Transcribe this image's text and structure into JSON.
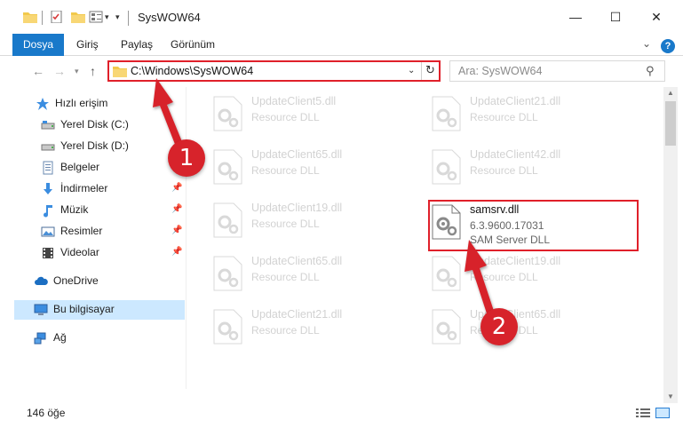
{
  "window": {
    "title": "SysWOW64",
    "minimize": "—",
    "maximize": "☐",
    "close": "✕"
  },
  "ribbon": {
    "tabs": [
      "Dosya",
      "Giriş",
      "Paylaş",
      "Görünüm"
    ],
    "help": "?"
  },
  "address": {
    "path": "C:\\Windows\\SysWOW64",
    "search_placeholder": "Ara: SysWOW64"
  },
  "sidebar": {
    "items": [
      {
        "label": "Hızlı erişim",
        "icon": "star-icon"
      },
      {
        "label": "Yerel Disk (C:)",
        "icon": "drive-icon"
      },
      {
        "label": "Yerel Disk (D:)",
        "icon": "drive-icon"
      },
      {
        "label": "Belgeler",
        "icon": "documents-icon"
      },
      {
        "label": "İndirmeler",
        "icon": "download-icon"
      },
      {
        "label": "Müzik",
        "icon": "music-icon"
      },
      {
        "label": "Resimler",
        "icon": "pictures-icon"
      },
      {
        "label": "Videolar",
        "icon": "video-icon"
      },
      {
        "label": "OneDrive",
        "icon": "cloud-icon"
      },
      {
        "label": "Bu bilgisayar",
        "icon": "computer-icon"
      },
      {
        "label": "Ağ",
        "icon": "network-icon"
      }
    ]
  },
  "files": {
    "left": [
      {
        "name": "UpdateClient5.dll",
        "desc": "Resource DLL"
      },
      {
        "name": "UpdateClient65.dll",
        "desc": "Resource DLL"
      },
      {
        "name": "UpdateClient19.dll",
        "desc": "Resource DLL"
      },
      {
        "name": "UpdateClient65.dll",
        "desc": "Resource DLL"
      },
      {
        "name": "UpdateClient21.dll",
        "desc": "Resource DLL"
      }
    ],
    "right": [
      {
        "name": "UpdateClient21.dll",
        "desc": "Resource DLL"
      },
      {
        "name": "UpdateClient42.dll",
        "desc": "Resource DLL"
      },
      {
        "name": "UpdateClient19.dll",
        "desc": "Resource DLL"
      },
      {
        "name": "UpdateClient65.dll",
        "desc": "Resource DLL"
      }
    ],
    "target": {
      "name": "samsrv.dll",
      "version": "6.3.9600.17031",
      "desc": "SAM Server DLL"
    }
  },
  "status": {
    "count": "146 öğe"
  },
  "callouts": {
    "step1": "1",
    "step2": "2"
  },
  "colors": {
    "accent": "#1979ca",
    "highlight": "#e0202a",
    "callout": "#d7232b",
    "selection": "#cce8ff"
  }
}
